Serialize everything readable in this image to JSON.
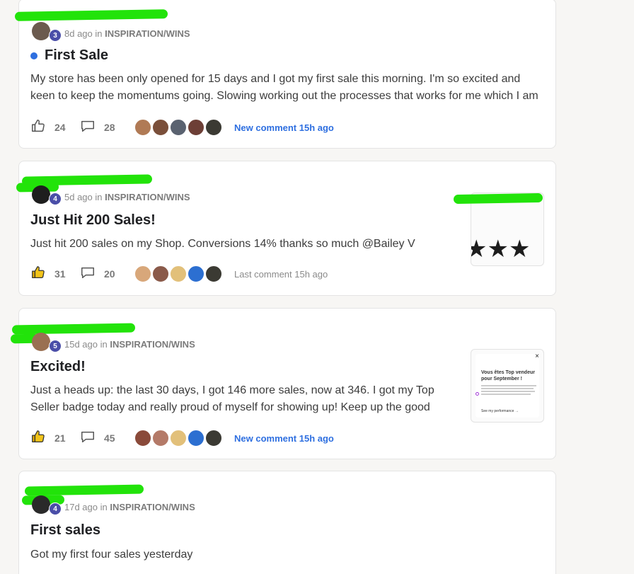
{
  "posts": [
    {
      "level": "3",
      "time": "8d ago",
      "in_word": "in",
      "category": "INSPIRATION/WINS",
      "title": "First Sale",
      "unread": true,
      "body": "My store has been only opened for 15 days and I got my first sale this morning. I'm so excited and keen to keep the momentums going. Slowing working out the processes that works for me which I am",
      "likes": "24",
      "comments": "28",
      "liked": false,
      "comment_note": "New comment 15h ago",
      "comment_note_new": true
    },
    {
      "level": "4",
      "time": "5d ago",
      "in_word": "in",
      "category": "INSPIRATION/WINS",
      "title": "Just Hit 200 Sales!",
      "unread": false,
      "body": "Just hit 200 sales on my Shop. Conversions 14% thanks so much @Bailey V",
      "likes": "31",
      "comments": "20",
      "liked": true,
      "comment_note": "Last comment 15h ago",
      "comment_note_new": false,
      "thumbnail": {
        "stars": "★★★"
      }
    },
    {
      "level": "5",
      "time": "15d ago",
      "in_word": "in",
      "category": "INSPIRATION/WINS",
      "title": "Excited!",
      "unread": false,
      "body": "Just a heads up: the last 30 days, I got 146 more sales, now at 346. I got my Top Seller badge today and really proud of myself for showing up! Keep up the good work,",
      "likes": "21",
      "comments": "45",
      "liked": true,
      "comment_note": "New comment 15h ago",
      "comment_note_new": true,
      "thumbnail": {
        "close": "×",
        "title": "Vous êtes Top vendeur pour September !",
        "link": "See my performance →"
      }
    },
    {
      "level": "4",
      "time": "17d ago",
      "in_word": "in",
      "category": "INSPIRATION/WINS",
      "title": "First sales",
      "unread": false,
      "body": "Got my first four sales yesterday"
    }
  ],
  "colors": {
    "accent": "#2e6fe0",
    "level_badge": "#4a4ea8",
    "redaction": "#22e30a",
    "like_active": "#e8b000"
  },
  "icons": {
    "like": "thumbs-up-icon",
    "comment": "comment-bubble-icon"
  }
}
